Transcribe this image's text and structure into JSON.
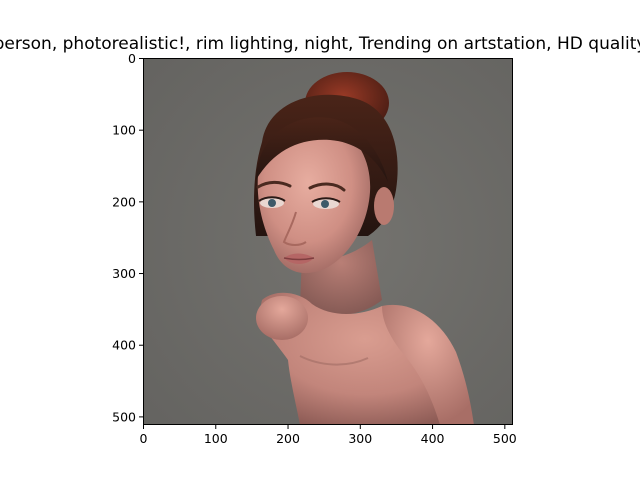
{
  "chart_data": {
    "type": "image",
    "title": "person,  photorealistic!, rim lighting, night, Trending on artstation, HD quality",
    "xlim": [
      0,
      512
    ],
    "ylim": [
      512,
      0
    ],
    "xticks": [
      0,
      100,
      200,
      300,
      400,
      500
    ],
    "yticks": [
      0,
      100,
      200,
      300,
      400,
      500
    ],
    "xtick_labels": [
      "0",
      "100",
      "200",
      "300",
      "400",
      "500"
    ],
    "ytick_labels": [
      "0",
      "100",
      "200",
      "300",
      "400",
      "500"
    ],
    "grid": false,
    "image_content": "portrait-photo",
    "colors": {
      "background": "#6c6b68",
      "hair": "#3a1f17",
      "hair_bun": "#7a2c1c",
      "skin": "#d79a8e",
      "skin_shadow": "#9e6a63",
      "lips": "#b56665",
      "eyes": "#3d5968"
    }
  }
}
